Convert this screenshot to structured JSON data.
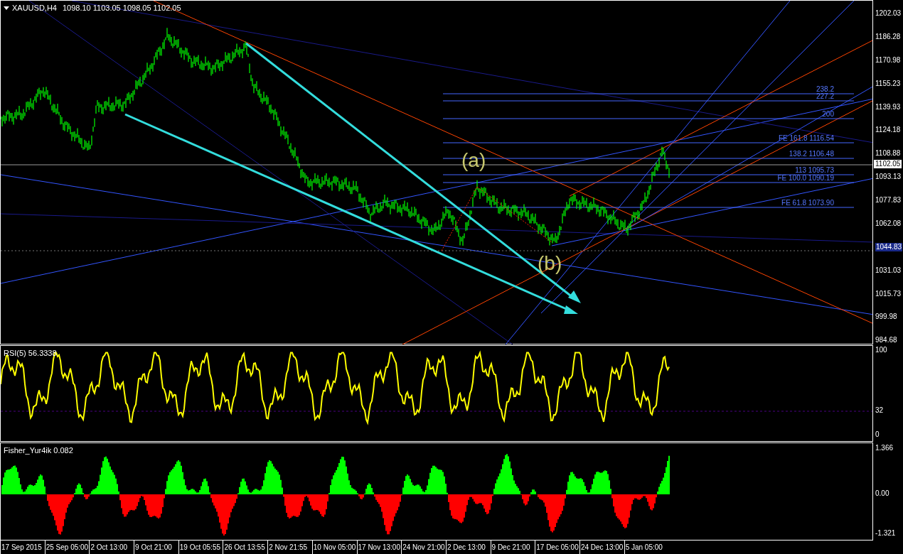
{
  "header": {
    "symbol": "XAUUSD,H4",
    "ohlc": "1098.10 1103.05 1098.05 1102.05"
  },
  "wave_labels": [
    "(a)",
    "(b)"
  ],
  "fib_levels": [
    {
      "label": "238.2"
    },
    {
      "label": "227.2"
    },
    {
      "label": "200"
    },
    {
      "label": "FE 161.8 1116.54"
    },
    {
      "label": "138.2 1106.48"
    },
    {
      "label": "113 1095.73"
    },
    {
      "label": "FE 100.0 1090.19"
    },
    {
      "label": "FE 61.8 1073.90"
    }
  ],
  "price_axis": [
    {
      "text": "1202.03",
      "kind": "plain"
    },
    {
      "text": "1186.28",
      "kind": "plain"
    },
    {
      "text": "1170.98",
      "kind": "plain"
    },
    {
      "text": "1155.23",
      "kind": "plain"
    },
    {
      "text": "1139.93",
      "kind": "plain"
    },
    {
      "text": "1124.18",
      "kind": "plain"
    },
    {
      "text": "1108.88",
      "kind": "plain"
    },
    {
      "text": "1093.13",
      "kind": "plain"
    },
    {
      "text": "1077.83",
      "kind": "plain"
    },
    {
      "text": "1062.08",
      "kind": "plain"
    },
    {
      "text": "1044.83",
      "kind": "marker"
    },
    {
      "text": "1031.03",
      "kind": "plain"
    },
    {
      "text": "1015.73",
      "kind": "plain"
    },
    {
      "text": "999.98",
      "kind": "plain"
    },
    {
      "text": "984.68",
      "kind": "plain"
    }
  ],
  "current_price": "1102.05",
  "rsi": {
    "title": "RSI(5) 56.3338",
    "axis": [
      "100",
      "32",
      "0"
    ]
  },
  "fisher": {
    "title": "Fisher_Yur4ik 0.082",
    "axis": [
      "1.366",
      "0.00",
      "-1.321"
    ]
  },
  "time_axis": [
    "17 Sep 2015",
    "25 Sep 05:00",
    "2 Oct 13:00",
    "9 Oct 21:00",
    "19 Oct 05:55",
    "26 Oct 13:55",
    "2 Nov 21:55",
    "10 Nov 05:00",
    "17 Nov 13:00",
    "24 Nov 21:00",
    "2 Dec 13:00",
    "9 Dec 21:00",
    "17 Dec 05:00",
    "24 Dec 13:00",
    "5 Jan 05:00"
  ]
}
